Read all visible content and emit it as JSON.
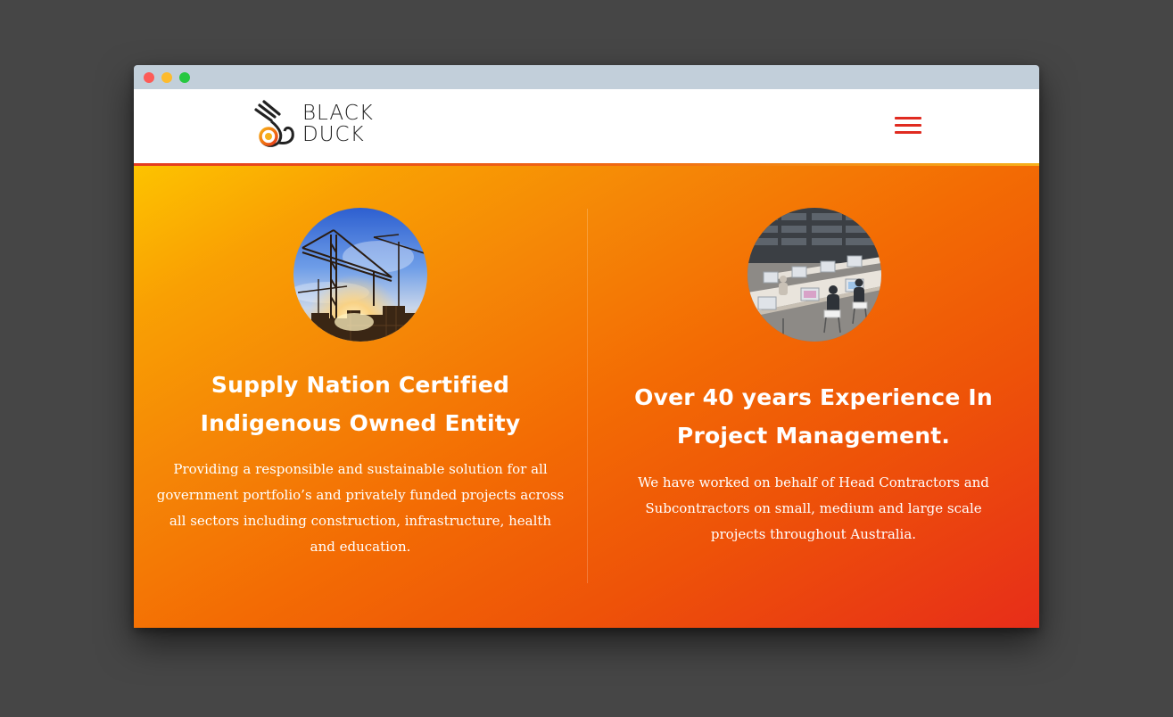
{
  "window": {
    "controls": [
      "close",
      "minimize",
      "maximize"
    ]
  },
  "header": {
    "logo": {
      "line1": "BLACK",
      "line2": "DUCK",
      "icon": "black-duck-icon"
    },
    "menu_icon": "hamburger-menu-icon",
    "accent_color": "#e02b20"
  },
  "hero": {
    "gradient": [
      "#fdc300",
      "#f58706",
      "#ee5308",
      "#e72d19"
    ],
    "columns": [
      {
        "image": "construction-cranes-photo",
        "heading_line1": "Supply Nation Certified",
        "heading_line2": "Indigenous Owned Entity",
        "text": "Providing a responsible and sustainable solution for all government portfolio’s and privately funded projects across all sectors including construction, infrastructure, health and education."
      },
      {
        "image": "office-workspace-photo",
        "heading_line1": "Over 40 years Experience In",
        "heading_line2": "Project Management.",
        "text": "We have worked on behalf of Head Contractors and Subcontractors on small, medium and large scale projects throughout Australia."
      }
    ]
  }
}
